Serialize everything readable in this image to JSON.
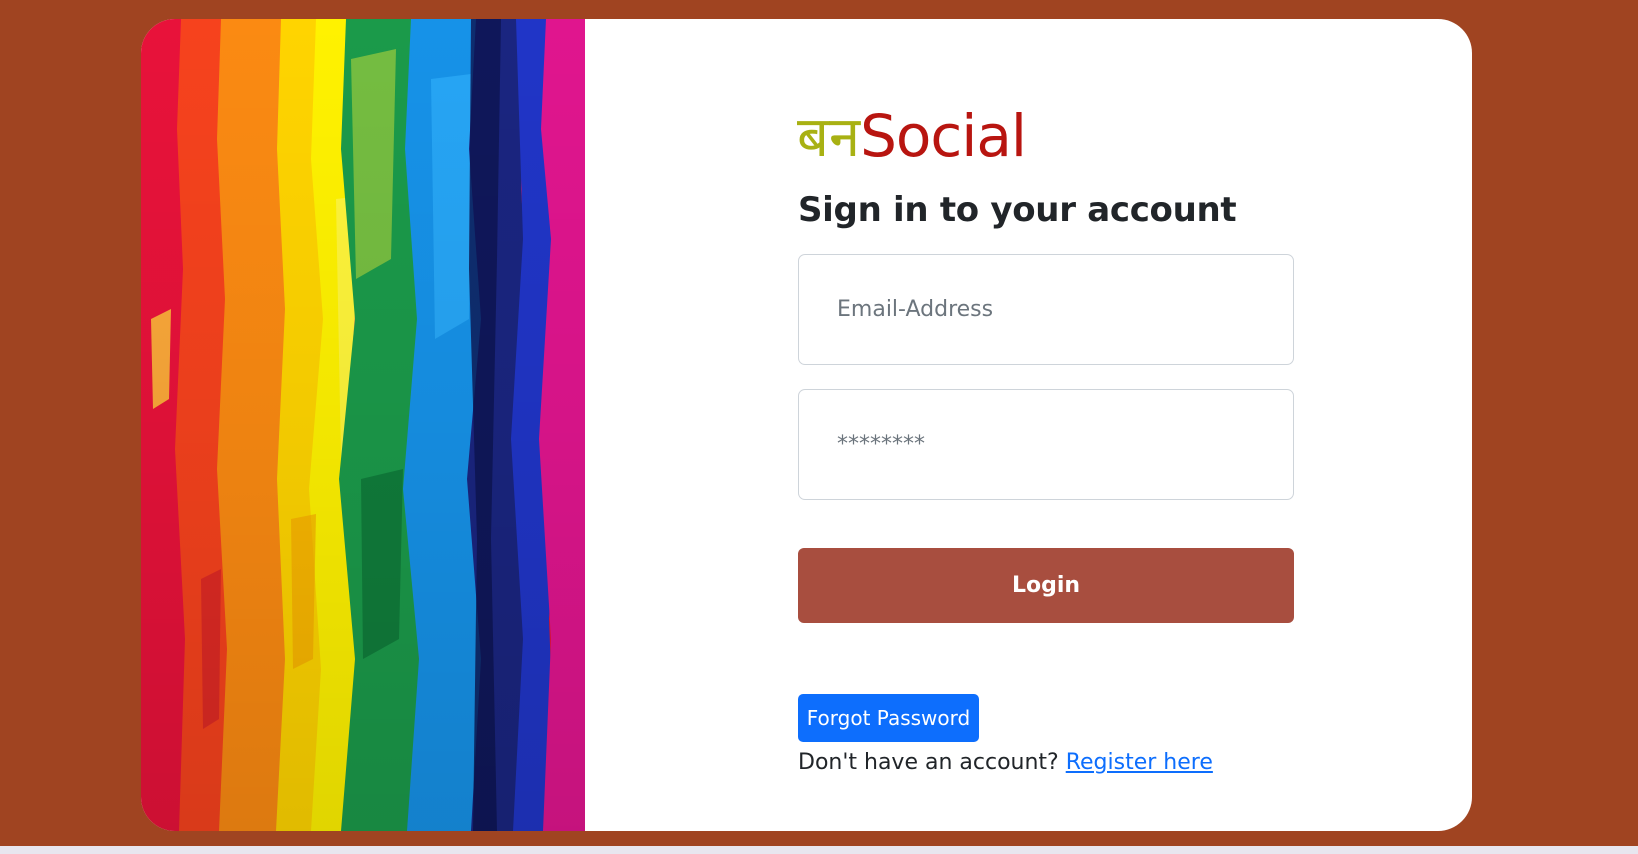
{
  "brand": {
    "devanagari": "बन",
    "latin": "Social",
    "devanagari_color": "#a8b113",
    "latin_color": "#b81510"
  },
  "login_form": {
    "title": "Sign in to your account",
    "email_placeholder": "Email-Address",
    "password_placeholder": "********",
    "login_label": "Login",
    "forgot_label": "Forgot Password",
    "register_prompt": "Don't have an account? ",
    "register_link": "Register here"
  },
  "colors": {
    "background": "#a04421",
    "card": "#ffffff",
    "login_button": "#a84e3f",
    "forgot_button": "#0d6efd",
    "link": "#0d6efd"
  }
}
